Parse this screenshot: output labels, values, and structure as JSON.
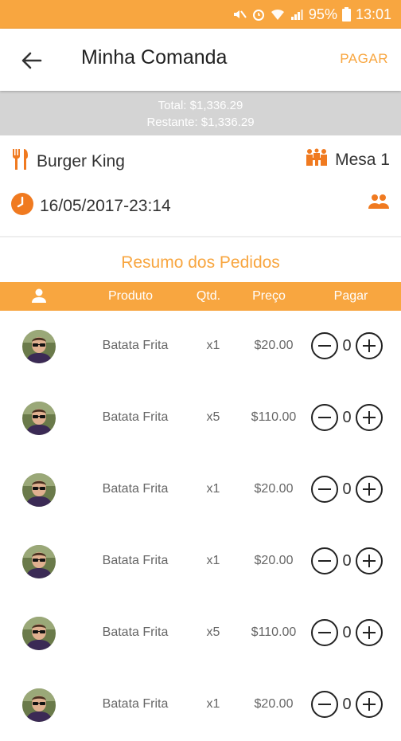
{
  "status_bar": {
    "battery": "95%",
    "time": "13:01"
  },
  "toolbar": {
    "title": "Minha Comanda",
    "pay_label": "PAGAR"
  },
  "summary": {
    "total": "Total: $1,336.29",
    "remaining": "Restante: $1,336.29"
  },
  "restaurant": {
    "name": "Burger King",
    "table": "Mesa 1",
    "datetime": "16/05/2017-23:14"
  },
  "orders": {
    "title": "Resumo dos Pedidos",
    "headers": {
      "product": "Produto",
      "qty": "Qtd.",
      "price": "Preço",
      "pay": "Pagar"
    },
    "rows": [
      {
        "product": "Batata Frita",
        "qty": "x1",
        "price": "$20.00",
        "pay_count": "0"
      },
      {
        "product": "Batata Frita",
        "qty": "x5",
        "price": "$110.00",
        "pay_count": "0"
      },
      {
        "product": "Batata Frita",
        "qty": "x1",
        "price": "$20.00",
        "pay_count": "0"
      },
      {
        "product": "Batata Frita",
        "qty": "x1",
        "price": "$20.00",
        "pay_count": "0"
      },
      {
        "product": "Batata Frita",
        "qty": "x5",
        "price": "$110.00",
        "pay_count": "0"
      },
      {
        "product": "Batata Frita",
        "qty": "x1",
        "price": "$20.00",
        "pay_count": "0"
      }
    ]
  },
  "colors": {
    "accent": "#f8a640",
    "summary_bg": "#d4d4d4",
    "table_icon": "#f07a20"
  }
}
